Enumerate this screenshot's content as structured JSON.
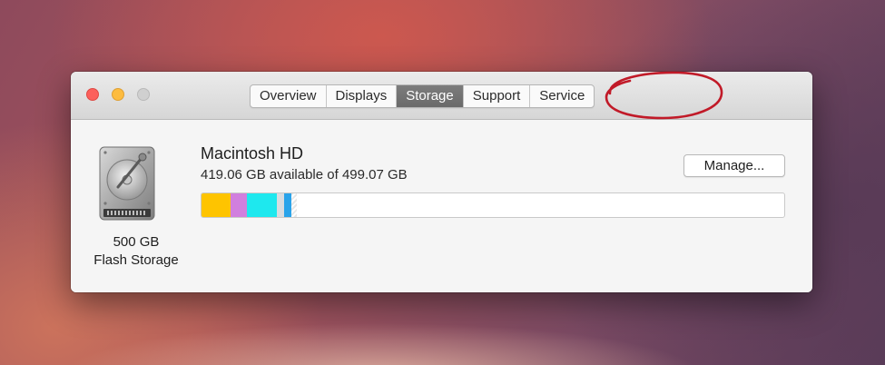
{
  "window": {
    "tabs": [
      {
        "label": "Overview",
        "selected": false
      },
      {
        "label": "Displays",
        "selected": false
      },
      {
        "label": "Storage",
        "selected": true
      },
      {
        "label": "Support",
        "selected": false
      },
      {
        "label": "Service",
        "selected": false
      }
    ]
  },
  "disk": {
    "icon": "hard-drive-icon",
    "capacity_label": "500 GB",
    "type_label": "Flash Storage"
  },
  "volume": {
    "name": "Macintosh HD",
    "available_text": "419.06 GB available of 499.07 GB",
    "manage_label": "Manage...",
    "usage_segments": [
      {
        "name": "yellow",
        "color": "#fec400",
        "percent": 5.0
      },
      {
        "name": "purple",
        "color": "#d17fde",
        "percent": 2.8
      },
      {
        "name": "cyan",
        "color": "#1ee8ee",
        "percent": 5.2
      },
      {
        "name": "light-gray",
        "color": "#d8dce0",
        "percent": 1.2
      },
      {
        "name": "blue",
        "color": "#29a3ea",
        "percent": 1.2
      },
      {
        "name": "other",
        "color": "striped",
        "percent": 0.9
      }
    ],
    "annotation_color": "#c11a28"
  }
}
